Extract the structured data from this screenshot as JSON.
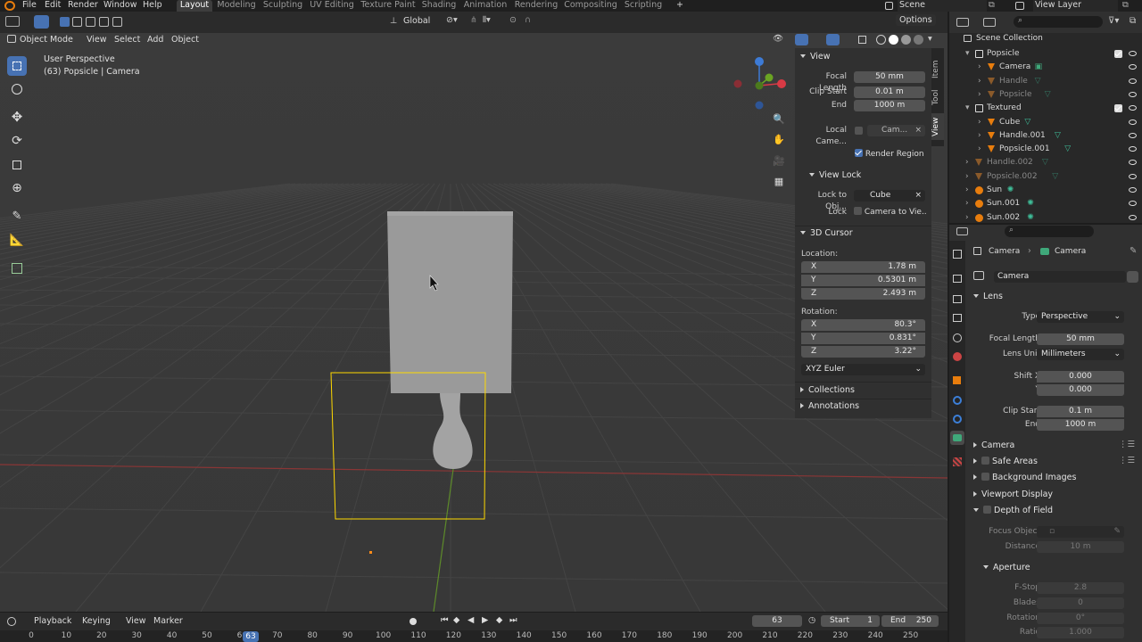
{
  "menu": {
    "items": [
      "File",
      "Edit",
      "Render",
      "Window",
      "Help"
    ],
    "workspaces": [
      "Layout",
      "Modeling",
      "Sculpting",
      "UV Editing",
      "Texture Paint",
      "Shading",
      "Animation",
      "Rendering",
      "Compositing",
      "Scripting"
    ],
    "scene": "Scene",
    "view_layer": "View Layer"
  },
  "toolbar": {
    "orientation": "Global",
    "options": "Options"
  },
  "viewport": {
    "mode": "Object Mode",
    "menus": [
      "View",
      "Select",
      "Add",
      "Object"
    ],
    "perspective": "User Perspective",
    "context": "(63) Popsicle | Camera"
  },
  "npanel": {
    "tabs": [
      "Item",
      "Tool",
      "View"
    ],
    "view": {
      "title": "View",
      "focal_length_label": "Focal Length",
      "focal_length": "50 mm",
      "clip_start_label": "Clip Start",
      "clip_start": "0.01 m",
      "end_label": "End",
      "end": "1000 m",
      "local_camera_label": "Local Came...",
      "local_camera": "Cam...",
      "render_region": "Render Region",
      "view_lock": "View Lock",
      "lock_to_obj_label": "Lock to Obj...",
      "lock_to_obj": "Cube",
      "lock_label": "Lock",
      "camera_to_view": "Camera to Vie..."
    },
    "cursor": {
      "title": "3D Cursor",
      "location_label": "Location:",
      "lx": "1.78 m",
      "ly": "0.5301 m",
      "lz": "2.493 m",
      "rotation_label": "Rotation:",
      "rx": "80.3°",
      "ry": "0.831°",
      "rz": "3.22°",
      "mode": "XYZ Euler",
      "x": "X",
      "y": "Y",
      "z": "Z"
    },
    "collections": "Collections",
    "annotations": "Annotations"
  },
  "outliner": {
    "root": "Scene Collection",
    "items": [
      {
        "name": "Popsicle",
        "indent": 0,
        "kind": "coll",
        "dim": false
      },
      {
        "name": "Camera",
        "indent": 1,
        "kind": "cam",
        "dim": false
      },
      {
        "name": "Handle",
        "indent": 1,
        "kind": "mesh",
        "dim": true
      },
      {
        "name": "Popsicle",
        "indent": 1,
        "kind": "mesh",
        "dim": true
      },
      {
        "name": "Textured",
        "indent": 0,
        "kind": "coll",
        "dim": false
      },
      {
        "name": "Cube",
        "indent": 1,
        "kind": "mesh",
        "dim": false
      },
      {
        "name": "Handle.001",
        "indent": 1,
        "kind": "mesh",
        "dim": false
      },
      {
        "name": "Popsicle.001",
        "indent": 1,
        "kind": "mesh",
        "dim": false
      },
      {
        "name": "Handle.002",
        "indent": 0,
        "kind": "mesh",
        "dim": true
      },
      {
        "name": "Popsicle.002",
        "indent": 0,
        "kind": "mesh",
        "dim": true
      },
      {
        "name": "Sun",
        "indent": 0,
        "kind": "light",
        "dim": false
      },
      {
        "name": "Sun.001",
        "indent": 0,
        "kind": "light",
        "dim": false
      },
      {
        "name": "Sun.002",
        "indent": 0,
        "kind": "light",
        "dim": false
      }
    ]
  },
  "properties": {
    "breadcrumb1": "Camera",
    "breadcrumb2": "Camera",
    "datablock": "Camera",
    "lens": "Lens",
    "type_label": "Type",
    "type": "Perspective",
    "focal_label": "Focal Length",
    "focal": "50 mm",
    "unit_label": "Lens Unit",
    "unit": "Millimeters",
    "shiftx_label": "Shift X",
    "shiftx": "0.000",
    "shifty_label": "Y",
    "shifty": "0.000",
    "clipstart_label": "Clip Start",
    "clipstart": "0.1 m",
    "clipend_label": "End",
    "clipend": "1000 m",
    "camera": "Camera",
    "safe_areas": "Safe Areas",
    "bg_images": "Background Images",
    "viewport_display": "Viewport Display",
    "dof": "Depth of Field",
    "focus_label": "Focus Object",
    "distance_label": "Distance",
    "distance": "10 m",
    "aperture": "Aperture",
    "fstop_label": "F-Stop",
    "fstop": "2.8",
    "blades_label": "Blades",
    "blades": "0",
    "rotation_label": "Rotation",
    "rotation": "0°",
    "ratio_label": "Ratio",
    "ratio": "1.000"
  },
  "timeline": {
    "menus": [
      "Playback",
      "Keying",
      "View",
      "Marker"
    ],
    "frame": "63",
    "start_label": "Start",
    "start": "1",
    "end_label": "End",
    "end": "250",
    "ticks": [
      "0",
      "10",
      "20",
      "30",
      "40",
      "50",
      "60",
      "70",
      "80",
      "90",
      "100",
      "110",
      "120",
      "130",
      "140",
      "150",
      "160",
      "170",
      "180",
      "190",
      "200",
      "210",
      "220",
      "230",
      "240",
      "250"
    ],
    "current": "63"
  },
  "colors": {
    "accent": "#4772b3",
    "select": "#ffd900"
  }
}
